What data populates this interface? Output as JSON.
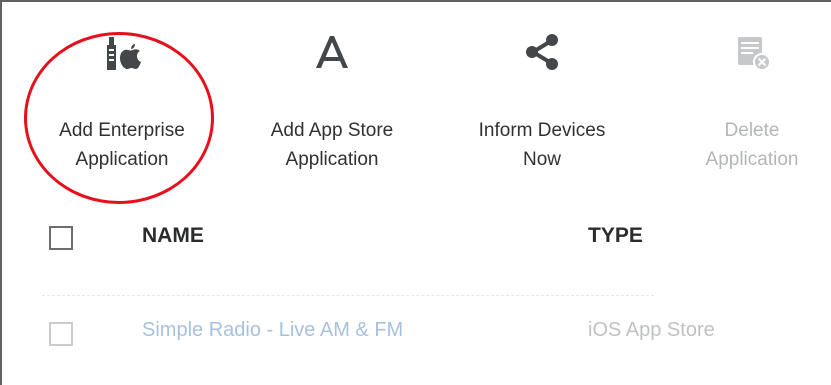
{
  "toolbar": {
    "buttons": [
      {
        "label": "Add Enterprise\nApplication",
        "icon": "enterprise-apple-icon"
      },
      {
        "label": "Add App Store\nApplication",
        "icon": "app-store-icon"
      },
      {
        "label": "Inform Devices\nNow",
        "icon": "share-icon"
      },
      {
        "label": "Delete\nApplication",
        "icon": "delete-app-icon"
      }
    ]
  },
  "table": {
    "columns": [
      "NAME",
      "TYPE"
    ],
    "rows": [
      {
        "name": "Simple Radio - Live AM & FM",
        "type": "iOS App Store"
      }
    ]
  },
  "colors": {
    "highlight_ring": "#e5101b",
    "icon": "#44474a",
    "disabled": "#b3b6b9",
    "link": "#a8c0df"
  }
}
